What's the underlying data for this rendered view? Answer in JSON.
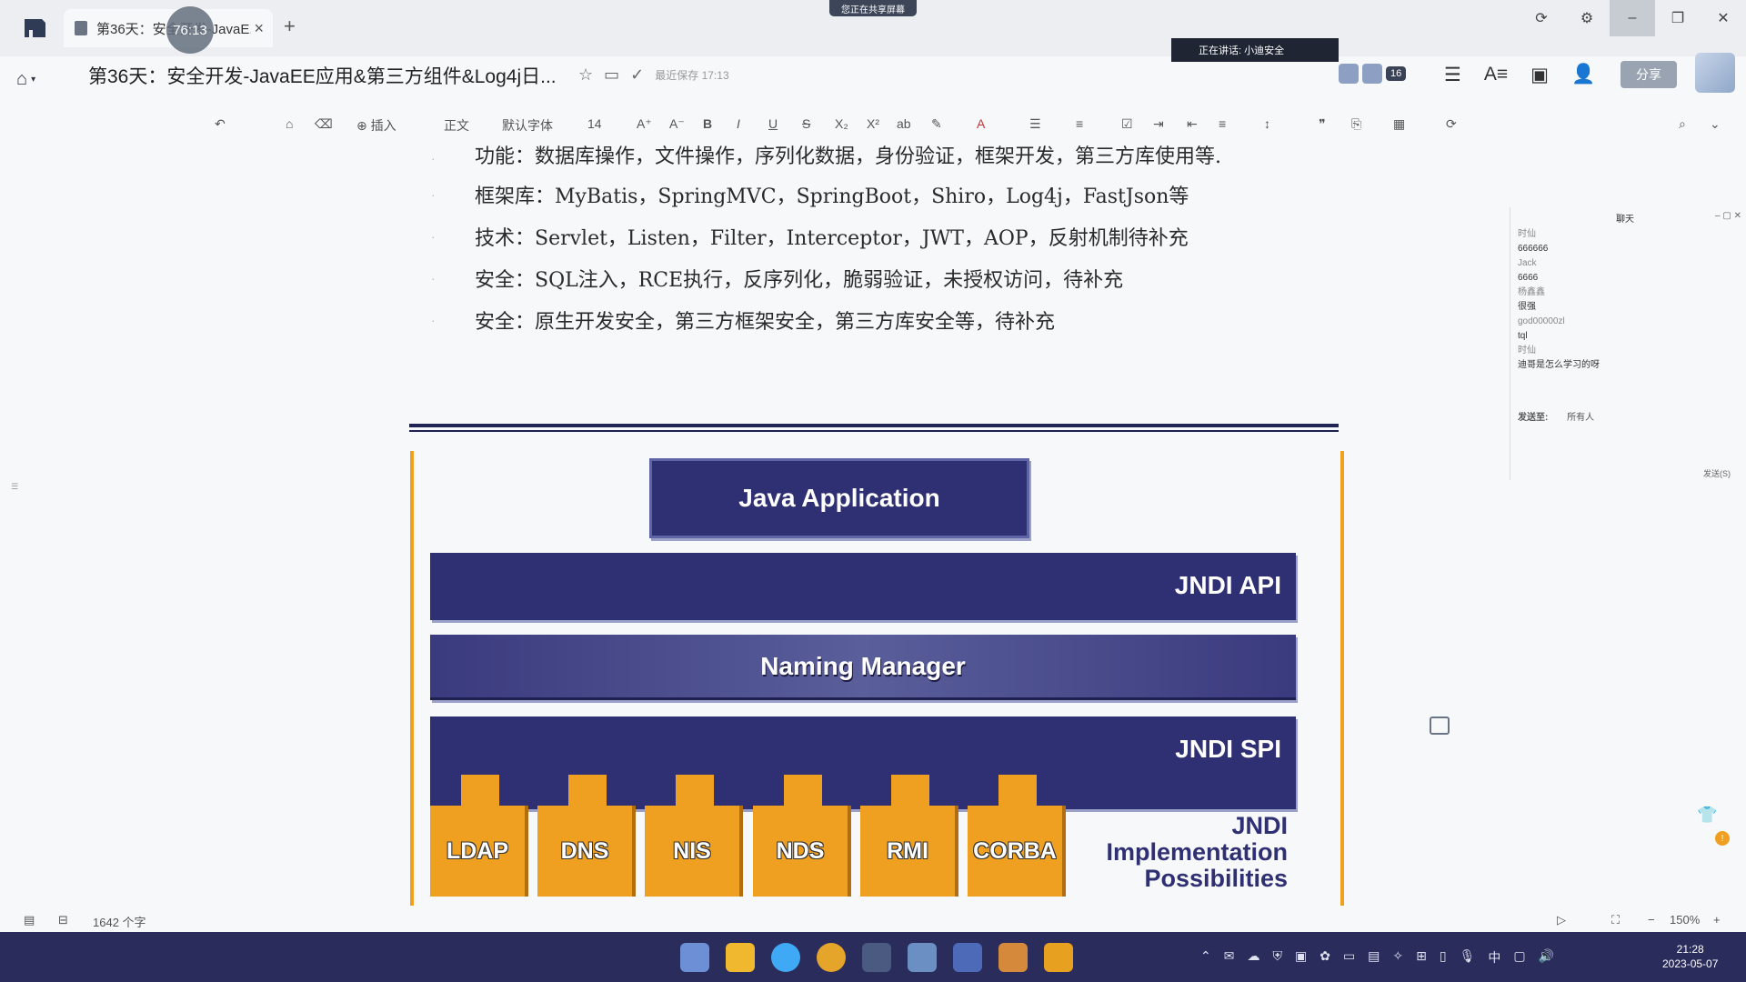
{
  "titlebar": {
    "tab_title": "第36天：安全开发-JavaE...",
    "timer": "76:13",
    "share_banner": "您正在共享屏幕",
    "new_tab": "+",
    "tab_close": "×"
  },
  "header": {
    "doc_title": "第36天：安全开发-JavaEE应用&第三方组件&Log4j日...",
    "saved_status": "最近保存 17:13",
    "speaking": "正在讲话: 小迪安全",
    "member_count": "16",
    "share_button": "分享"
  },
  "toolbar": {
    "insert": "插入",
    "style": "正文",
    "font": "默认字体",
    "size": "14"
  },
  "document": {
    "lines": [
      "功能：数据库操作，文件操作，序列化数据，身份验证，框架开发，第三方库使用等.",
      "框架库：MyBatis，SpringMVC，SpringBoot，Shiro，Log4j，FastJson等",
      "技术：Servlet，Listen，Filter，Interceptor，JWT，AOP，反射机制待补充",
      "安全：SQL注入，RCE执行，反序列化，脆弱验证，未授权访问，待补充",
      "安全：原生开发安全，第三方框架安全，第三方库安全等，待补充"
    ],
    "diagram": {
      "app": "Java Application",
      "api": "JNDI API",
      "naming": "Naming Manager",
      "spi": "JNDI SPI",
      "providers": [
        "LDAP",
        "DNS",
        "NIS",
        "NDS",
        "RMI",
        "CORBA"
      ],
      "impl_line1": "JNDI",
      "impl_line2": "Implementation",
      "impl_line3": "Possibilities"
    }
  },
  "chat": {
    "title": "聊天",
    "messages": [
      {
        "name": "时仙",
        "text": "666666"
      },
      {
        "name": "Jack",
        "text": "6666"
      },
      {
        "name": "杨鑫鑫",
        "text": "很强"
      },
      {
        "name": "god00000zl",
        "text": "tql"
      },
      {
        "name": "时仙",
        "text": "迪哥是怎么学习的呀"
      }
    ],
    "send_to_label": "发送至:",
    "send_to_value": "所有人",
    "send_button": "发送(S)"
  },
  "statusbar": {
    "word_count": "1642 个字",
    "zoom": "150%"
  },
  "taskbar": {
    "time": "21:28",
    "date": "2023-05-07",
    "ime": "中"
  },
  "colors": {
    "diagram_navy": "#2f2f73",
    "diagram_orange": "#f0a020",
    "taskbar": "#2a2c5c"
  }
}
